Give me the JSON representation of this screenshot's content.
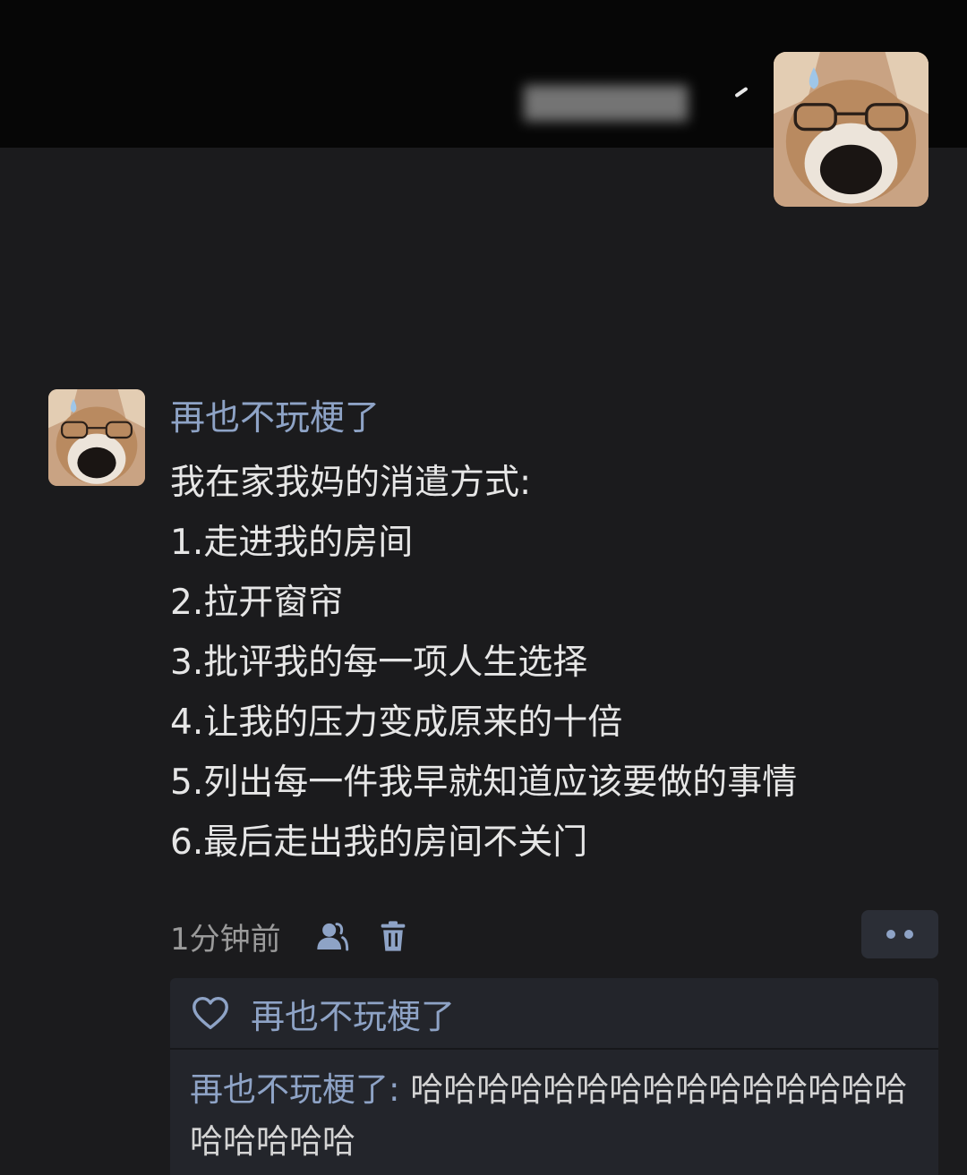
{
  "header": {
    "blurred_text": "███████",
    "avatar_icon": "shiba-dog-glasses-avatar"
  },
  "comment": {
    "author": "再也不玩梗了",
    "avatar_icon": "shiba-dog-glasses-avatar",
    "lines": [
      "我在家我妈的消遣方式:",
      "1.走进我的房间",
      "2.拉开窗帘",
      "3.批评我的每一项人生选择",
      "4.让我的压力变成原来的十倍",
      "5.列出每一件我早就知道应该要做的事情",
      "6.最后走出我的房间不关门"
    ],
    "time": "1分钟前",
    "icons": [
      "user-icon",
      "trash-icon",
      "more-dots-icon"
    ]
  },
  "reply_box": {
    "like_icon": "heart-outline-icon",
    "liker": "再也不玩梗了",
    "reply_author": "再也不玩梗了",
    "reply_separator": ": ",
    "reply_text": "哈哈哈哈哈哈哈哈哈哈哈哈哈哈哈哈哈哈哈哈"
  },
  "colors": {
    "background": "#1b1b1d",
    "top_bar": "#060606",
    "accent": "#8ea3c6",
    "text": "#e6e6e6",
    "muted": "#9a9a9a",
    "reply_bg": "#23252b"
  }
}
